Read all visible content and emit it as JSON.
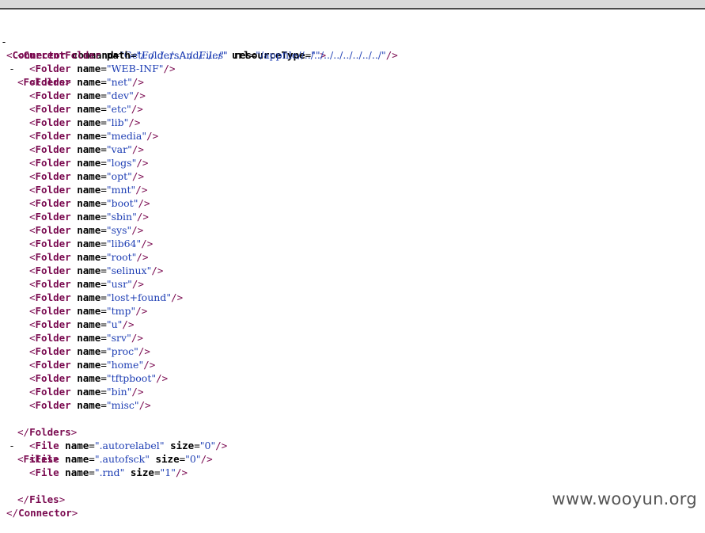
{
  "connector": {
    "name": "Connector",
    "attrs": [
      {
        "name": "command",
        "value": "GetFoldersAndFiles"
      },
      {
        "name": "resourceType",
        "value": ""
      }
    ],
    "toggle": "-"
  },
  "current_folder": {
    "name": "CurrentFolder",
    "attrs": [
      {
        "name": "path",
        "value": "/../../../../../../../../"
      },
      {
        "name": "url",
        "value": "/appfile//../../../../../../../../"
      }
    ]
  },
  "folders": {
    "name": "Folders",
    "toggle": "-",
    "item_name": "Folder",
    "item_attr": "name",
    "items": [
      "WEB-INF",
      "net",
      "dev",
      "etc",
      "lib",
      "media",
      "var",
      "logs",
      "opt",
      "mnt",
      "boot",
      "sbin",
      "sys",
      "lib64",
      "root",
      "selinux",
      "usr",
      "lost+found",
      "tmp",
      "u",
      "srv",
      "proc",
      "home",
      "tftpboot",
      "bin",
      "misc"
    ]
  },
  "files": {
    "name": "Files",
    "toggle": "-",
    "item_name": "File",
    "items": [
      {
        "name": ".autorelabel",
        "size": "0"
      },
      {
        "name": ".autofsck",
        "size": "0"
      },
      {
        "name": ".rnd",
        "size": "1"
      }
    ]
  },
  "watermark": "www.wooyun.org"
}
